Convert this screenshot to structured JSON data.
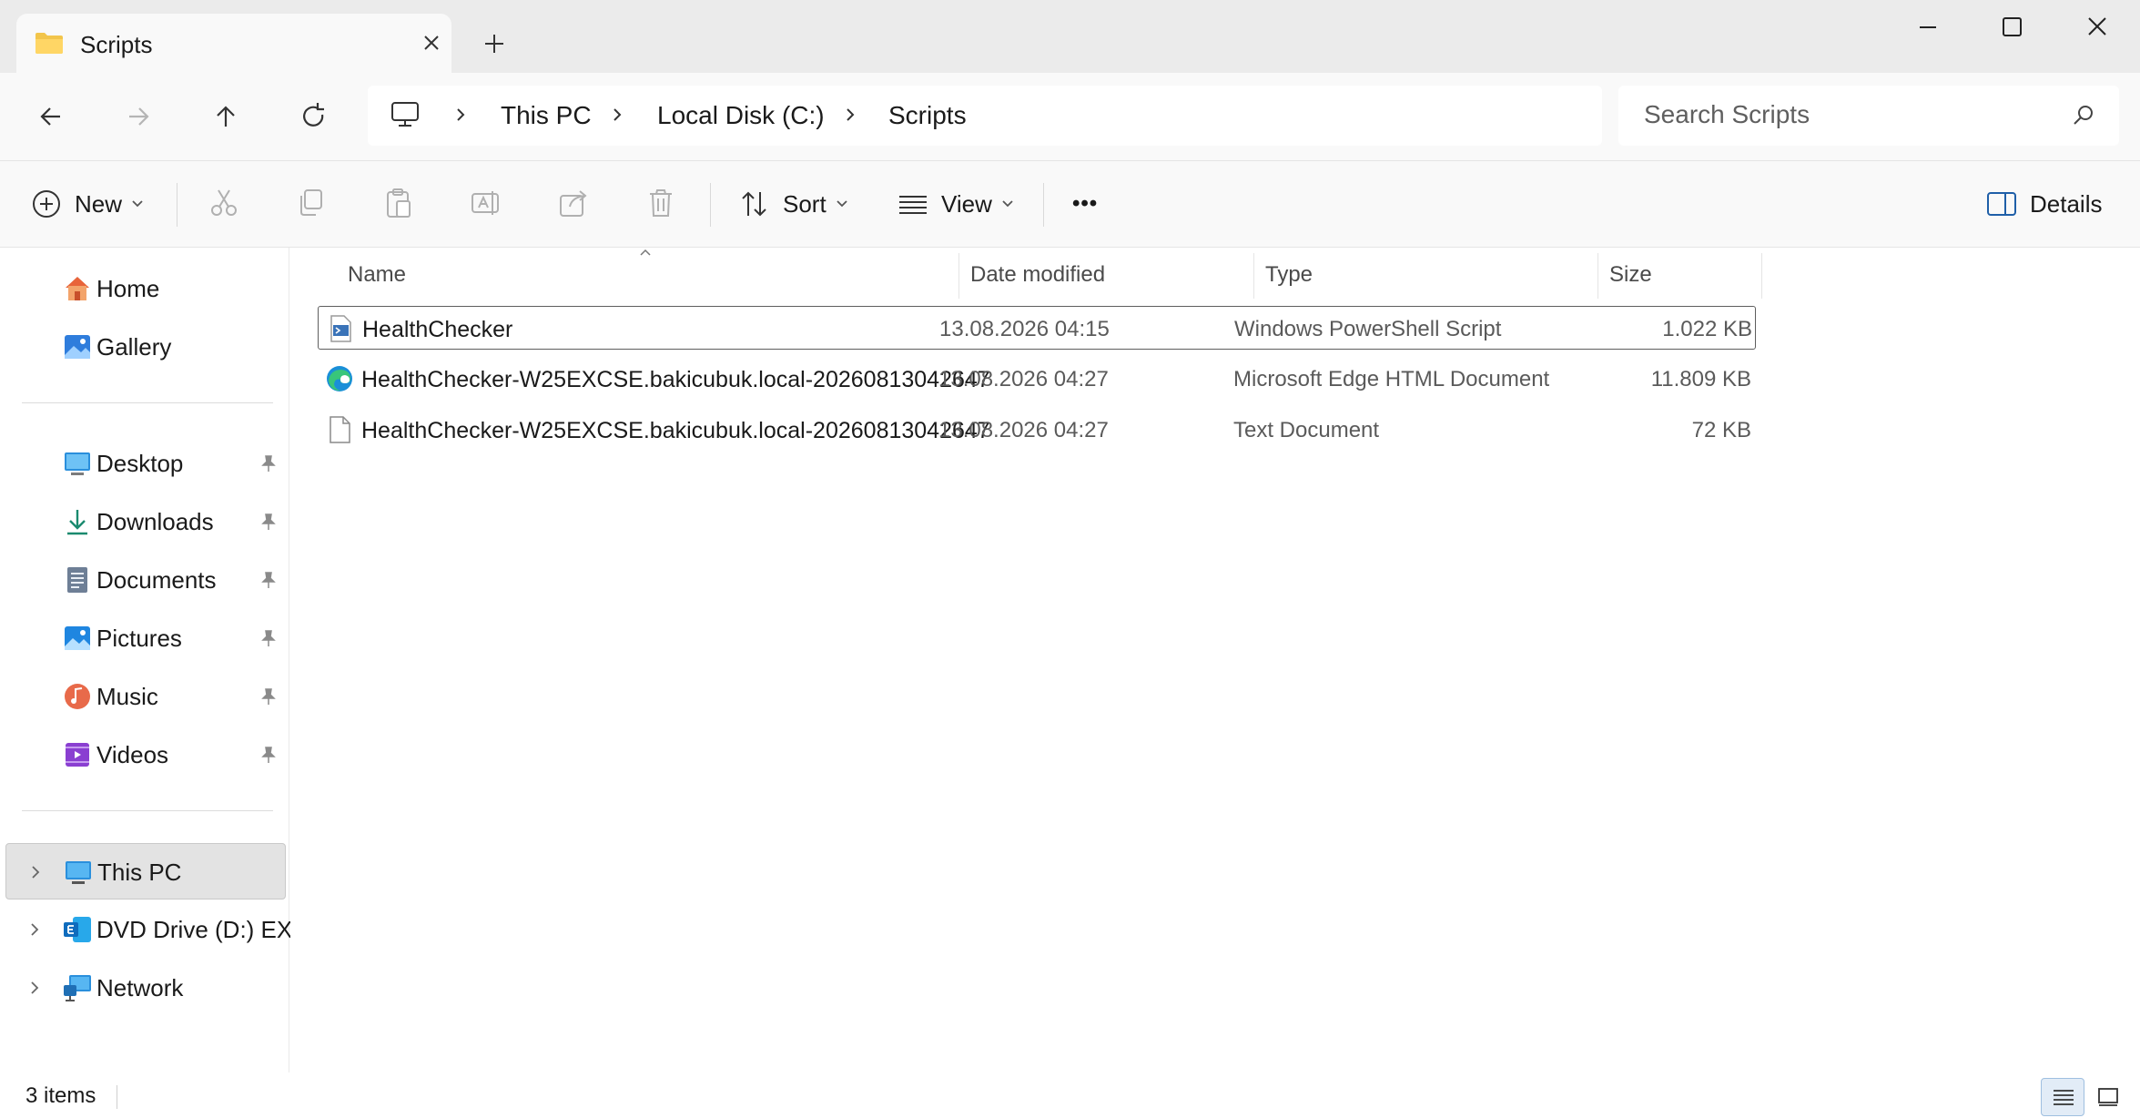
{
  "window": {
    "tab_title": "Scripts",
    "tab_icon": "folder-icon",
    "new_tab_icon": "plus-icon",
    "controls": [
      "minimize-icon",
      "maximize-icon",
      "close-icon"
    ]
  },
  "navigation": {
    "buttons": [
      "back-arrow-icon",
      "forward-arrow-icon",
      "up-arrow-icon",
      "refresh-icon"
    ],
    "breadcrumb": [
      "This PC",
      "Local Disk (C:)",
      "Scripts"
    ],
    "search_placeholder": "Search Scripts"
  },
  "commandbar": {
    "new_label": "New",
    "sort_label": "Sort",
    "view_label": "View",
    "more_label": "•••",
    "details_label": "Details",
    "icons": [
      "cut-icon",
      "copy-icon",
      "paste-icon",
      "rename-icon",
      "share-icon",
      "delete-icon"
    ]
  },
  "sidebar": {
    "top": [
      {
        "label": "Home",
        "icon": "home-icon"
      },
      {
        "label": "Gallery",
        "icon": "gallery-icon"
      }
    ],
    "pinned": [
      {
        "label": "Desktop",
        "icon": "desktop-icon"
      },
      {
        "label": "Downloads",
        "icon": "downloads-icon"
      },
      {
        "label": "Documents",
        "icon": "documents-icon"
      },
      {
        "label": "Pictures",
        "icon": "pictures-icon"
      },
      {
        "label": "Music",
        "icon": "music-icon"
      },
      {
        "label": "Videos",
        "icon": "videos-icon"
      }
    ],
    "drives": [
      {
        "label": "This PC",
        "icon": "this-pc-icon",
        "selected": true
      },
      {
        "label": "DVD Drive (D:) EXCI",
        "icon": "dvd-drive-icon"
      },
      {
        "label": "Network",
        "icon": "network-icon"
      }
    ]
  },
  "filelist": {
    "columns": [
      "Name",
      "Date modified",
      "Type",
      "Size"
    ],
    "files": [
      {
        "name": "HealthChecker",
        "date": "13.08.2026 04:15",
        "type": "Windows PowerShell Script",
        "size": "1.022 KB",
        "icon": "powershell-script-icon"
      },
      {
        "name": "HealthChecker-W25EXCSE.bakicubuk.local-20260813042647",
        "date": "13.08.2026 04:27",
        "type": "Microsoft Edge HTML Document",
        "size": "11.809 KB",
        "icon": "edge-icon"
      },
      {
        "name": "HealthChecker-W25EXCSE.bakicubuk.local-20260813042647",
        "date": "13.08.2026 04:27",
        "type": "Text Document",
        "size": "72 KB",
        "icon": "text-document-icon"
      }
    ]
  },
  "status": {
    "item_count": "3 items"
  }
}
